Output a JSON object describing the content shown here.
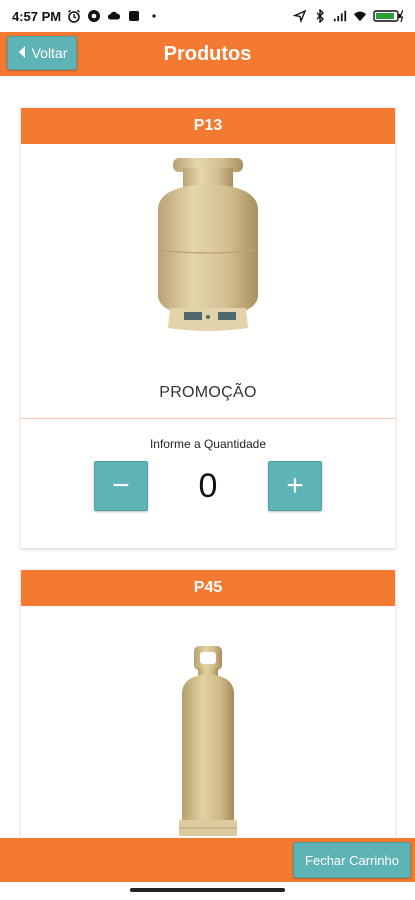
{
  "status_bar": {
    "time": "4:57 PM",
    "left_icons": [
      "alarm-icon",
      "chrome-icon",
      "cloud-icon",
      "notification-icon",
      "dot-icon"
    ],
    "right_icons": [
      "location-icon",
      "bluetooth-icon",
      "signal-icon",
      "wifi-icon",
      "battery-icon"
    ],
    "battery_level": 0.9
  },
  "header": {
    "back_label": "Voltar",
    "title": "Produtos"
  },
  "products": [
    {
      "name": "P13",
      "caption": "PROMOÇÃO",
      "quantity_label": "Informe a Quantidade",
      "quantity": "0",
      "minus_label": "−",
      "plus_label": "+"
    },
    {
      "name": "P45"
    }
  ],
  "footer": {
    "checkout_label": "Fechar Carrinho"
  },
  "colors": {
    "primary": "#f47a32",
    "button": "#5eb3b7",
    "cylinder": "#d8c49a"
  }
}
